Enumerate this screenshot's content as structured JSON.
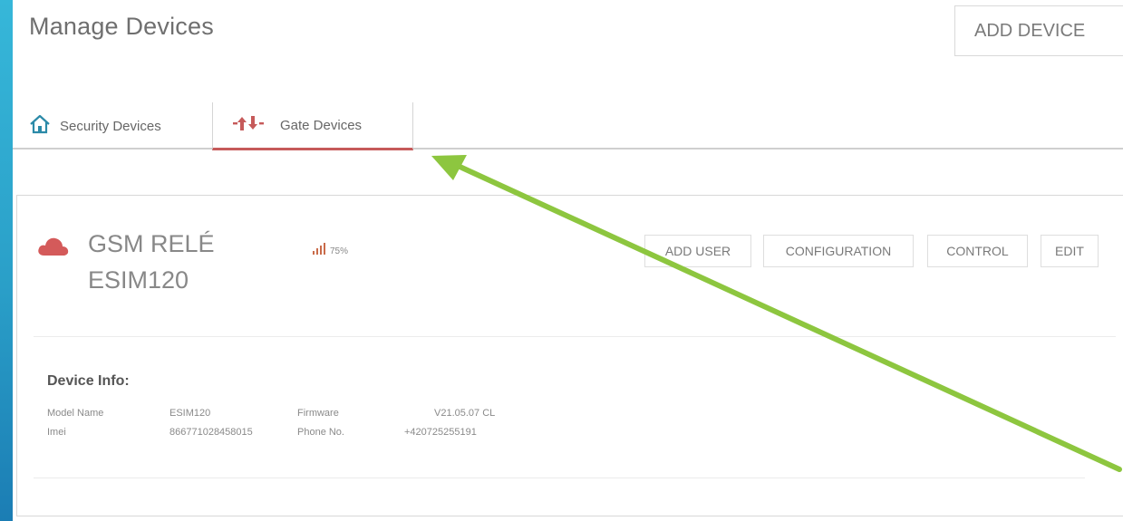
{
  "header": {
    "title": "Manage Devices",
    "add_device_label": "ADD DEVICE"
  },
  "tabs": [
    {
      "label": "Security Devices",
      "icon": "house-icon",
      "active": false
    },
    {
      "label": "Gate Devices",
      "icon": "up-down-arrows-icon",
      "active": true
    }
  ],
  "device": {
    "name_line1": "GSM RELÉ",
    "name_line2": "ESIM120",
    "signal": "75%",
    "actions": {
      "add_user": "ADD USER",
      "configuration": "CONFIGURATION",
      "control": "CONTROL",
      "edit": "EDIT"
    },
    "info_title": "Device Info:",
    "info": {
      "model_label": "Model Name",
      "model_value": "ESIM120",
      "firmware_label": "Firmware",
      "firmware_value": "V21.05.07 CL",
      "imei_label": "Imei",
      "imei_value": "866771028458015",
      "phone_label": "Phone No.",
      "phone_value": "+420725255191"
    }
  },
  "colors": {
    "accent": "#c65a5a",
    "arrow": "#8dc63f",
    "background": "#2a9fc8"
  }
}
